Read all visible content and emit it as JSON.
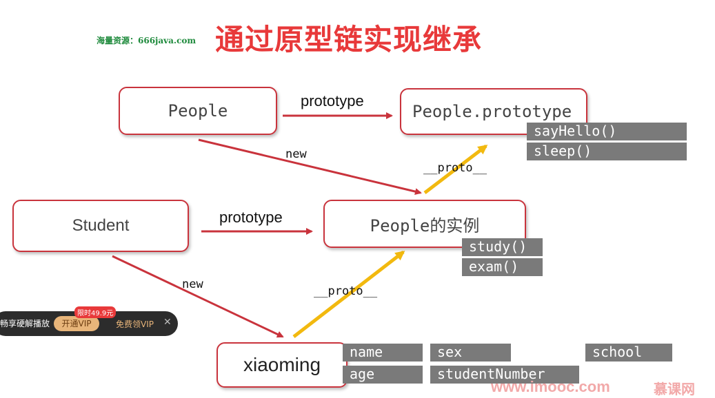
{
  "watermark": "海量资源：666java.com",
  "title": "通过原型链实现继承",
  "nodes": {
    "people": "People",
    "people_prototype": "People.prototype",
    "student": "Student",
    "people_instance": "People的实例",
    "xiaoming": "xiaoming"
  },
  "labels": {
    "prototype_top": "prototype",
    "prototype_mid": "prototype",
    "new_top": "new",
    "new_bottom": "new",
    "proto_top": "__proto__",
    "proto_bottom": "__proto__"
  },
  "methods": {
    "people_prototype": [
      "sayHello()",
      "sleep()"
    ],
    "people_instance": [
      "study()",
      "exam()"
    ]
  },
  "properties": {
    "name": "name",
    "age": "age",
    "sex": "sex",
    "studentNumber": "studentNumber",
    "school": "school"
  },
  "toolbar": {
    "text": "畅享硬解播放",
    "vip_button": "开通VIP",
    "badge": "限时49.9元",
    "free": "免费领VIP",
    "close": "✕"
  },
  "footer": {
    "logo": "www.imooc.com",
    "logo2": "慕课网"
  },
  "colors": {
    "box_border": "#c9333c",
    "arrow_red": "#c9333c",
    "arrow_yellow": "#f2b90f",
    "method_bg": "#7a7a7a",
    "title": "#e8393a"
  }
}
